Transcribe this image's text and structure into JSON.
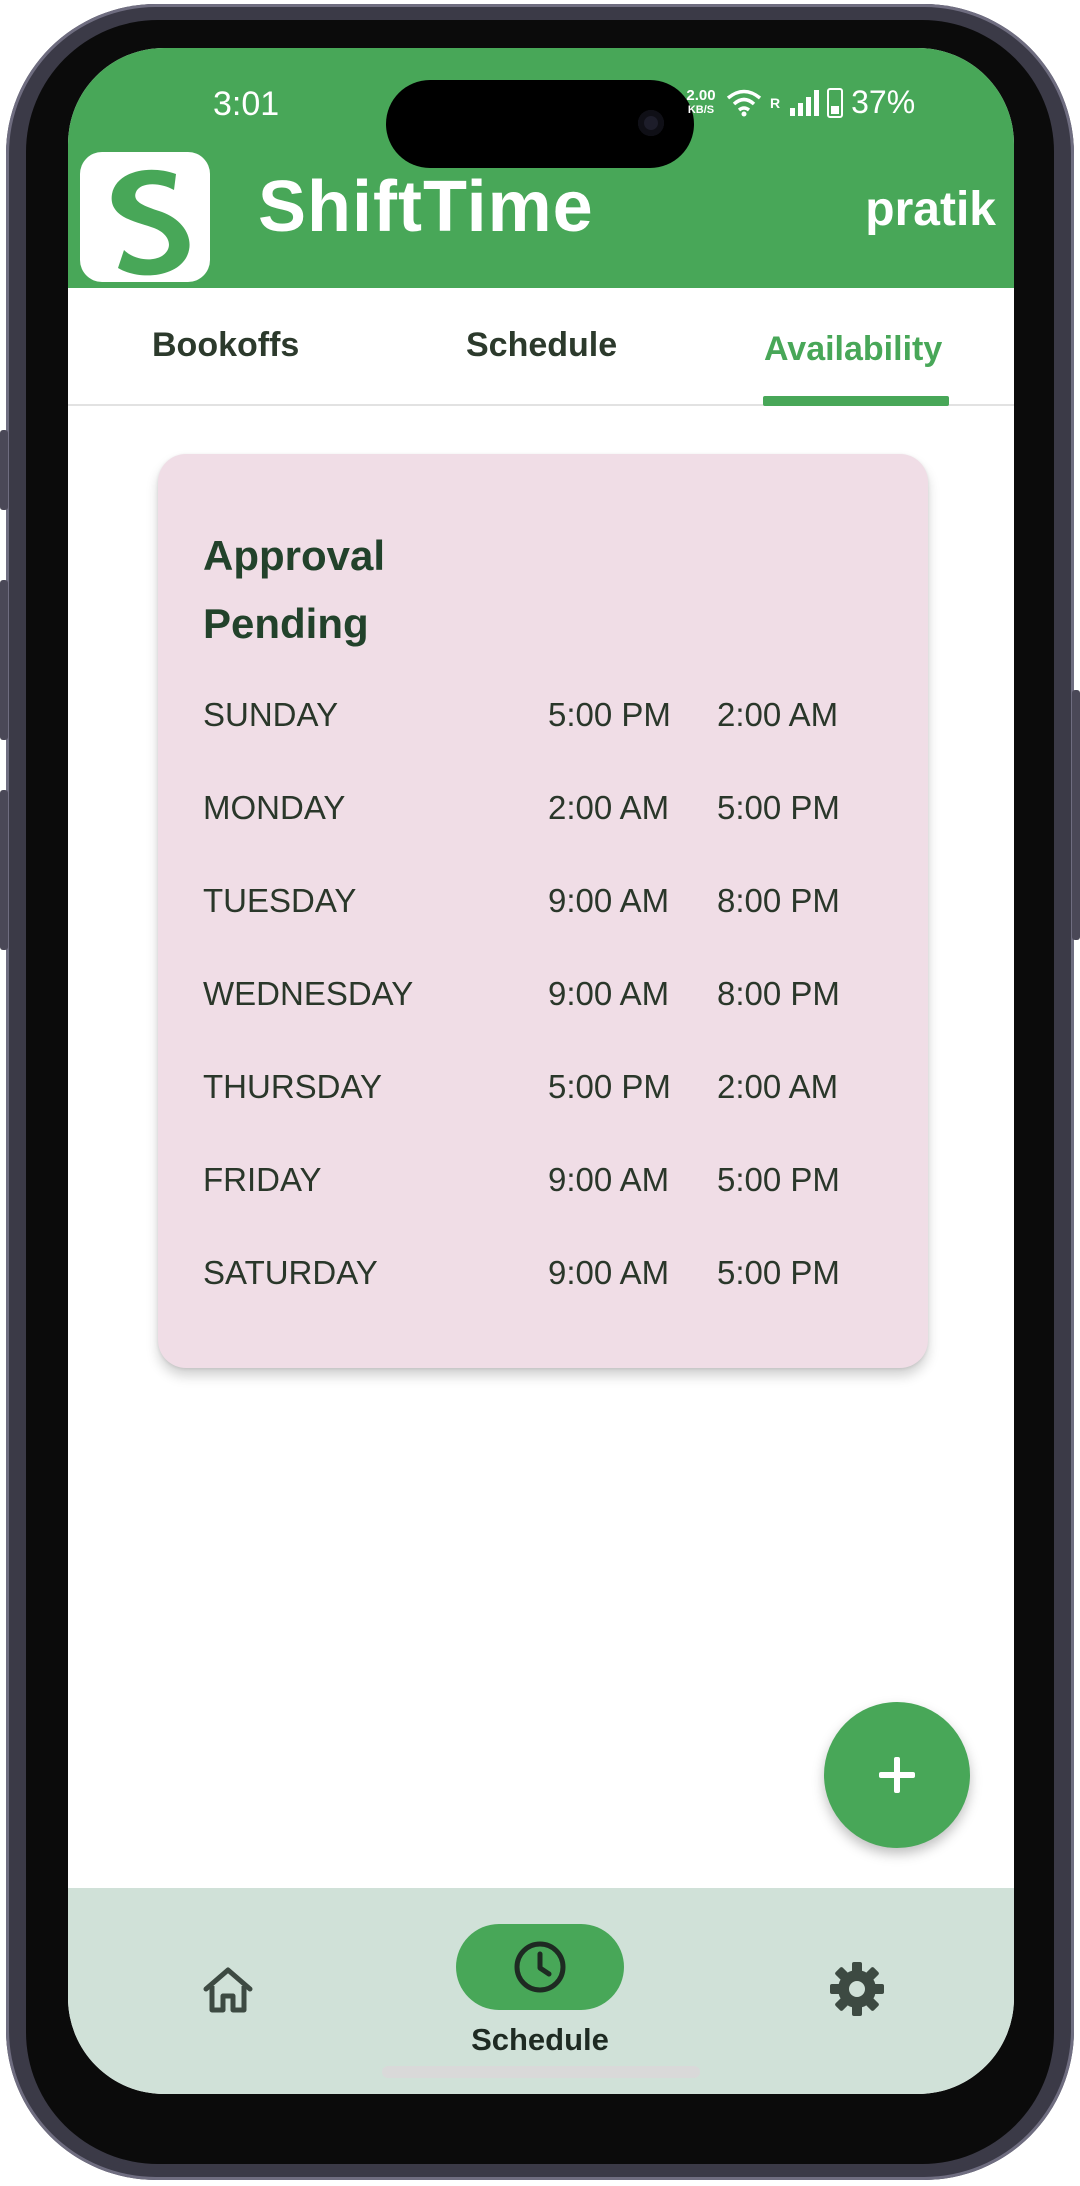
{
  "status_bar": {
    "time": "3:01",
    "net_speed_value": "2.00",
    "net_speed_unit": "KB/S",
    "signal_label": "R",
    "battery": "37%"
  },
  "header": {
    "app_name": "ShiftTime",
    "user": "pratik"
  },
  "tabs": [
    {
      "label": "Bookoffs"
    },
    {
      "label": "Schedule"
    },
    {
      "label": "Availability"
    }
  ],
  "active_tab": "Availability",
  "card": {
    "title": "Approval Pending",
    "rows": [
      {
        "day": "SUNDAY",
        "start": "5:00 PM",
        "end": "2:00 AM"
      },
      {
        "day": "MONDAY",
        "start": "2:00 AM",
        "end": "5:00 PM"
      },
      {
        "day": "TUESDAY",
        "start": "9:00 AM",
        "end": "8:00 PM"
      },
      {
        "day": "WEDNESDAY",
        "start": "9:00 AM",
        "end": "8:00 PM"
      },
      {
        "day": "THURSDAY",
        "start": "5:00 PM",
        "end": "2:00 AM"
      },
      {
        "day": "FRIDAY",
        "start": "9:00 AM",
        "end": "5:00 PM"
      },
      {
        "day": "SATURDAY",
        "start": "9:00 AM",
        "end": "5:00 PM"
      }
    ]
  },
  "bottom_nav": {
    "active_label": "Schedule",
    "items": [
      {
        "icon": "home-icon"
      },
      {
        "icon": "clock-icon"
      },
      {
        "icon": "gear-icon"
      }
    ]
  },
  "colors": {
    "brand_green": "#48a758",
    "card_pink": "#f0dde6",
    "nav_bg": "#d0e1d8"
  }
}
